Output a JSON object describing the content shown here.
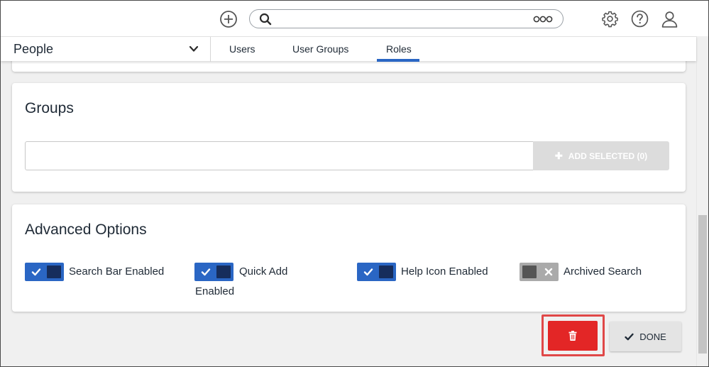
{
  "header": {
    "add_icon": "plus-circle-icon",
    "search": {
      "placeholder": "",
      "icon": "search-icon",
      "more_icon": "more-dots-icon"
    },
    "settings_icon": "gear-icon",
    "help_icon": "help-icon",
    "user_icon": "user-icon"
  },
  "nav": {
    "section": "People",
    "tabs": [
      {
        "label": "Users",
        "active": false
      },
      {
        "label": "User Groups",
        "active": false
      },
      {
        "label": "Roles",
        "active": true
      }
    ]
  },
  "groups": {
    "title": "Groups",
    "input_value": "",
    "add_button": "ADD SELECTED (0)"
  },
  "advanced": {
    "title": "Advanced Options",
    "options": [
      {
        "label": "Search Bar Enabled",
        "enabled": true
      },
      {
        "label": "Quick Add",
        "label_line2": "Enabled",
        "enabled": true
      },
      {
        "label": "Help Icon Enabled",
        "enabled": true
      },
      {
        "label": "Archived Search",
        "enabled": false
      }
    ]
  },
  "actions": {
    "delete_icon": "trash-icon",
    "done_label": "DONE"
  },
  "colors": {
    "accent": "#2a66c4",
    "toggle_knob_on": "#162d5c",
    "delete": "#e32626",
    "highlight": "#e04848"
  }
}
